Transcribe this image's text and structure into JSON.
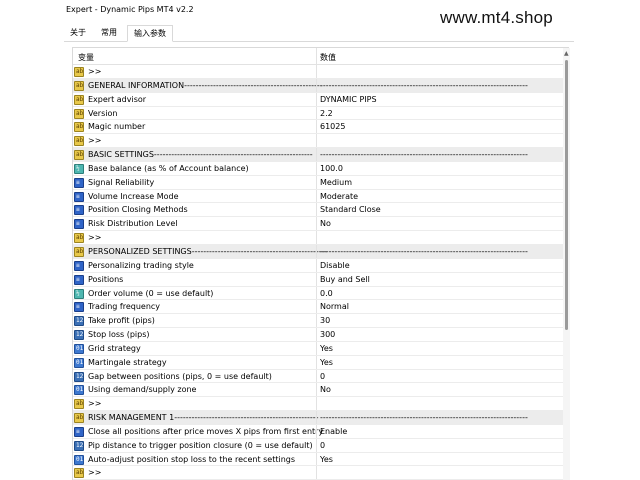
{
  "window": {
    "title": "Expert - Dynamic Pips MT4 v2.2"
  },
  "watermark": "www.mt4.shop",
  "tabs": [
    {
      "label": "关于",
      "active": false
    },
    {
      "label": "常用",
      "active": false
    },
    {
      "label": "输入参数",
      "active": true
    }
  ],
  "table": {
    "col_variable": "变量",
    "col_value": "数值",
    "rows": [
      {
        "type": "string",
        "name": ">>",
        "value": "",
        "section": false
      },
      {
        "type": "string",
        "name": "GENERAL INFORMATION------------------------------------------------",
        "value": "------------------------------------------------------------------------",
        "section": true
      },
      {
        "type": "string",
        "name": "Expert advisor",
        "value": "DYNAMIC PIPS",
        "section": false
      },
      {
        "type": "string",
        "name": "Version",
        "value": "2.2",
        "section": false
      },
      {
        "type": "string",
        "name": "Magic number",
        "value": "61025",
        "section": false
      },
      {
        "type": "string",
        "name": ">>",
        "value": "",
        "section": false
      },
      {
        "type": "string",
        "name": "BASIC SETTINGS-------------------------------------------------------",
        "value": "------------------------------------------------------------------------",
        "section": true
      },
      {
        "type": "double",
        "name": "Base balance (as % of Account balance)",
        "value": "100.0",
        "section": false
      },
      {
        "type": "enum",
        "name": "Signal Reliability",
        "value": "Medium",
        "section": false
      },
      {
        "type": "enum",
        "name": "Volume Increase Mode",
        "value": "Moderate",
        "section": false
      },
      {
        "type": "enum",
        "name": "Position Closing Methods",
        "value": "Standard Close",
        "section": false
      },
      {
        "type": "enum",
        "name": "Risk Distribution Level",
        "value": "No",
        "section": false
      },
      {
        "type": "string",
        "name": ">>",
        "value": "",
        "section": false
      },
      {
        "type": "string",
        "name": "PERSONALIZED SETTINGS-----------------------------------------------",
        "value": "------------------------------------------------------------------------",
        "section": true
      },
      {
        "type": "enum",
        "name": "Personalizing trading style",
        "value": "Disable",
        "section": false
      },
      {
        "type": "enum",
        "name": "Positions",
        "value": "Buy and Sell",
        "section": false
      },
      {
        "type": "double",
        "name": "Order volume (0 = use default)",
        "value": "0.0",
        "section": false
      },
      {
        "type": "enum",
        "name": "Trading frequency",
        "value": "Normal",
        "section": false
      },
      {
        "type": "int",
        "name": "Take profit (pips)",
        "value": "30",
        "section": false
      },
      {
        "type": "int",
        "name": "Stop loss (pips)",
        "value": "300",
        "section": false
      },
      {
        "type": "bool",
        "name": "Grid strategy",
        "value": "Yes",
        "section": false
      },
      {
        "type": "bool",
        "name": "Martingale strategy",
        "value": "Yes",
        "section": false
      },
      {
        "type": "int",
        "name": "Gap between positions (pips, 0 = use default)",
        "value": "0",
        "section": false
      },
      {
        "type": "bool",
        "name": "Using demand/supply zone",
        "value": "No",
        "section": false
      },
      {
        "type": "string",
        "name": ">>",
        "value": "",
        "section": false
      },
      {
        "type": "string",
        "name": "RISK MANAGEMENT 1--------------------------------------------------",
        "value": "------------------------------------------------------------------------",
        "section": true
      },
      {
        "type": "enum",
        "name": "Close all positions after price moves X pips from first entry",
        "value": "Enable",
        "section": false
      },
      {
        "type": "int",
        "name": "Pip distance to trigger position closure (0 = use default)",
        "value": "0",
        "section": false
      },
      {
        "type": "bool",
        "name": "Auto-adjust position stop loss to the recent settings",
        "value": "Yes",
        "section": false
      },
      {
        "type": "string",
        "name": ">>",
        "value": "",
        "section": false
      }
    ]
  }
}
